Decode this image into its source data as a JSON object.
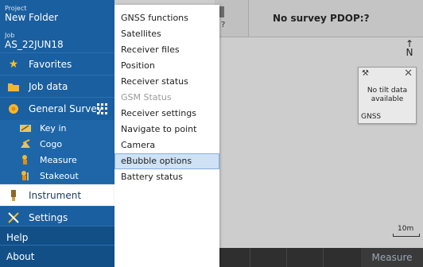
{
  "sidebar": {
    "project_label": "Project",
    "project_value": "New Folder",
    "job_label": "Job",
    "job_value": "AS_22JUN18",
    "items": [
      {
        "label": "Favorites",
        "icon": "star-icon"
      },
      {
        "label": "Job data",
        "icon": "folder-icon"
      },
      {
        "label": "General Survey",
        "icon": "survey-icon"
      },
      {
        "label": "Key in",
        "icon": "key-in-icon"
      },
      {
        "label": "Cogo",
        "icon": "cogo-icon"
      },
      {
        "label": "Measure",
        "icon": "measure-icon"
      },
      {
        "label": "Stakeout",
        "icon": "stakeout-icon"
      },
      {
        "label": "Instrument",
        "icon": "instrument-icon"
      },
      {
        "label": "Settings",
        "icon": "settings-icon"
      },
      {
        "label": "Help"
      },
      {
        "label": "About"
      }
    ]
  },
  "menu": {
    "items": [
      {
        "label": "GNSS functions"
      },
      {
        "label": "Satellites"
      },
      {
        "label": "Receiver files"
      },
      {
        "label": "Position"
      },
      {
        "label": "Receiver status"
      },
      {
        "label": "GSM Status",
        "disabled": true
      },
      {
        "label": "Receiver settings"
      },
      {
        "label": "Navigate to point"
      },
      {
        "label": "Camera"
      },
      {
        "label": "eBubble options",
        "highlighted": true
      },
      {
        "label": "Battery status"
      }
    ]
  },
  "map": {
    "status_text": "No survey  PDOP:?",
    "status_icon_text": "?",
    "north_label": "N",
    "tilt_card": {
      "message": "No tilt data available",
      "source": "GNSS"
    },
    "scale_label": "10m",
    "measure_button": "Measure"
  },
  "colors": {
    "sidebar_bg": "#1a5fa0",
    "menu_highlight": "#cfe2f5",
    "selected_item_bg": "#ffffff"
  }
}
